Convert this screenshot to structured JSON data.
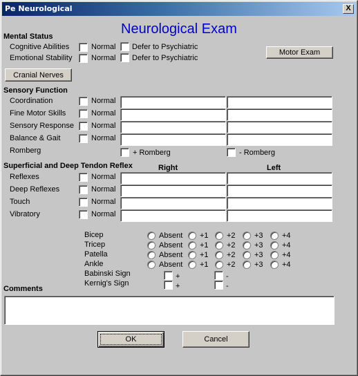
{
  "window": {
    "title": "Pe Neurological",
    "close_label": "X"
  },
  "header": {
    "title": "Neurological Exam"
  },
  "mental_status": {
    "heading": "Mental Status",
    "rows": [
      {
        "label": "Cognitive Abilities",
        "normal_label": "Normal",
        "defer_label": "Defer to Psychiatric"
      },
      {
        "label": "Emotional Stability",
        "normal_label": "Normal",
        "defer_label": "Defer to Psychiatric"
      }
    ],
    "motor_exam_button": "Motor Exam",
    "cranial_nerves_button": "Cranial Nerves"
  },
  "sensory_function": {
    "heading": "Sensory Function",
    "rows": [
      {
        "label": "Coordination",
        "normal_label": "Normal",
        "right_value": "",
        "left_value": ""
      },
      {
        "label": "Fine Motor Skills",
        "normal_label": "Normal",
        "right_value": "",
        "left_value": ""
      },
      {
        "label": "Sensory Response",
        "normal_label": "Normal",
        "right_value": "",
        "left_value": ""
      },
      {
        "label": "Balance & Gait",
        "normal_label": "Normal",
        "right_value": "",
        "left_value": ""
      }
    ],
    "romberg": {
      "label": "Romberg",
      "positive_label": "+ Romberg",
      "negative_label": "- Romberg"
    }
  },
  "reflex": {
    "heading": "Superficial and Deep Tendon Reflex",
    "right_header": "Right",
    "left_header": "Left",
    "rows": [
      {
        "label": "Reflexes",
        "normal_label": "Normal",
        "right_value": "",
        "left_value": ""
      },
      {
        "label": "Deep Reflexes",
        "normal_label": "Normal",
        "right_value": "",
        "left_value": ""
      },
      {
        "label": "Touch",
        "normal_label": "Normal",
        "right_value": "",
        "left_value": ""
      },
      {
        "label": "Vibratory",
        "normal_label": "Normal",
        "right_value": "",
        "left_value": ""
      }
    ]
  },
  "grading": {
    "options": [
      "Absent",
      "+1",
      "+2",
      "+3",
      "+4"
    ],
    "rows": [
      {
        "label": "Bicep"
      },
      {
        "label": "Tricep"
      },
      {
        "label": "Patella"
      },
      {
        "label": "Ankle"
      }
    ],
    "signs": [
      {
        "label": "Babinski Sign",
        "positive_label": "+",
        "negative_label": "-"
      },
      {
        "label": "Kernig's Sign",
        "positive_label": "+",
        "negative_label": "-"
      }
    ]
  },
  "comments": {
    "heading": "Comments",
    "value": ""
  },
  "footer": {
    "ok_label": "OK",
    "cancel_label": "Cancel"
  }
}
